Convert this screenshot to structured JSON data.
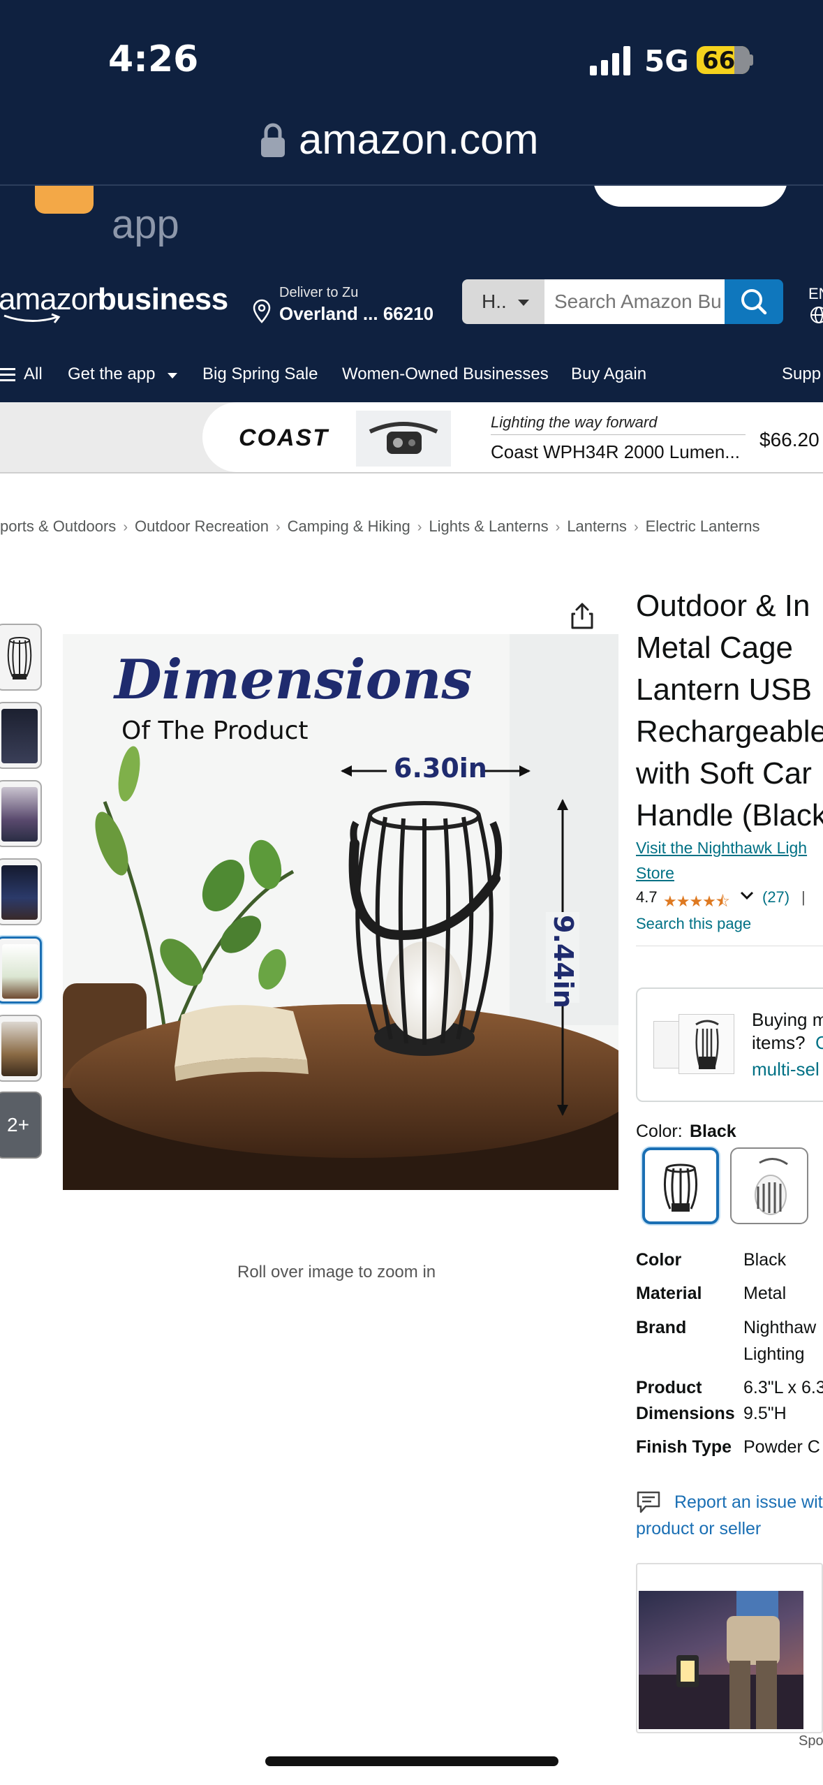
{
  "status_bar": {
    "time": "4:26",
    "network": "5G",
    "battery": "66"
  },
  "browser": {
    "url": "amazon.com"
  },
  "app_banner": {
    "text": "app"
  },
  "header": {
    "logo_part1": "amazon",
    "logo_part2": "business",
    "deliver_line1": "Deliver to Zu",
    "deliver_line2": "Overland ... 66210",
    "search_category": "H..",
    "search_placeholder": "Search Amazon Bu",
    "lang": "EN"
  },
  "nav": {
    "all": "All",
    "get_app": "Get the app",
    "spring_sale": "Big Spring Sale",
    "women_owned": "Women-Owned Businesses",
    "buy_again": "Buy Again",
    "support": "Supp"
  },
  "ad": {
    "brand": "COAST",
    "tagline": "Lighting the way forward",
    "title": "Coast WPH34R 2000 Lumen...",
    "price": "$66.20"
  },
  "breadcrumbs": [
    "ports & Outdoors",
    "Outdoor Recreation",
    "Camping & Hiking",
    "Lights & Lanterns",
    "Lanterns",
    "Electric Lanterns"
  ],
  "gallery": {
    "more_label": "2+",
    "main_image": {
      "heading": "Dimensions",
      "subheading": "Of The Product",
      "width_label": "6.30in",
      "height_label": "9.44in"
    },
    "zoom_hint": "Roll over image to zoom in"
  },
  "product": {
    "title": "Outdoor & In Metal Cage Lantern USB Rechargeable with Soft Car Handle (Black",
    "store_link": "Visit the Nighthawk Ligh Store",
    "rating": "4.7",
    "stars": "★★★★⯪",
    "review_count": "(27)",
    "rating_sep": "|",
    "search_page": "Search this page"
  },
  "buy_box": {
    "line1": "Buying m",
    "line2": "items?",
    "line2_link": "C",
    "line3": "multi-sel"
  },
  "color": {
    "label": "Color:",
    "value": "Black"
  },
  "specs": [
    {
      "key": "Color",
      "value": "Black"
    },
    {
      "key": "Material",
      "value": "Metal"
    },
    {
      "key": "Brand",
      "value": "Nighthaw",
      "value2": "Lighting"
    },
    {
      "key": "Product",
      "key2": "Dimensions",
      "value": "6.3\"L x 6.3",
      "value2": "9.5\"H"
    },
    {
      "key": "Finish Type",
      "value": "Powder C"
    }
  ],
  "report": {
    "line1": "Report an issue with",
    "line2": "product or seller"
  },
  "sponsored": {
    "label": "Spo"
  },
  "colors": {
    "header_bg": "#0f2140",
    "link": "#007185",
    "search_btn": "#0f77bd",
    "star": "#de7921",
    "selected_border": "#1a6fb4"
  }
}
